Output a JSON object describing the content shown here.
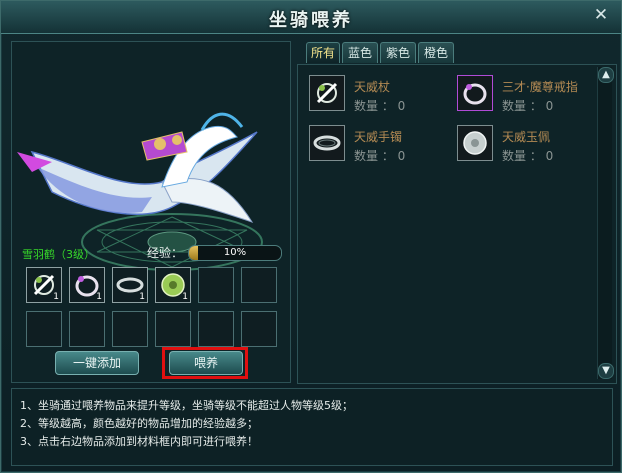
{
  "window": {
    "title": "坐骑喂养",
    "close_label": "✕"
  },
  "tabs": [
    {
      "label": "所有",
      "active": true
    },
    {
      "label": "蓝色",
      "active": false
    },
    {
      "label": "紫色",
      "active": false
    },
    {
      "label": "橙色",
      "active": false
    }
  ],
  "items": [
    {
      "name": "天威杖",
      "qty": "数量 ： 0",
      "icon": "staff-icon"
    },
    {
      "name": "三才·魔尊戒指",
      "qty": "数量 ： 0",
      "icon": "ring-icon"
    },
    {
      "name": "天威手镯",
      "qty": "数量 ： 0",
      "icon": "bracelet-icon"
    },
    {
      "name": "天威玉佩",
      "qty": "数量 ： 0",
      "icon": "jade-pendant-icon"
    }
  ],
  "mount": {
    "name": "雪羽鹤（3级）",
    "exp_label": "经验：",
    "exp_text": "10%",
    "exp_fraction": 0.1
  },
  "slots": [
    {
      "icon": "staff-icon",
      "count": "1"
    },
    {
      "icon": "ring-icon",
      "count": "1"
    },
    {
      "icon": "bracelet-icon",
      "count": "1"
    },
    {
      "icon": "jade-pendant-icon",
      "count": "1"
    }
  ],
  "buttons": {
    "add_all": "一键添加",
    "feed": "喂养"
  },
  "tips": [
    "1、坐骑通过喂养物品来提升等级，坐骑等级不能超过人物等级5级；",
    "2、等级越高，颜色越好的物品增加的经验越多；",
    "3、点击右边物品添加到材料框内即可进行喂养！"
  ],
  "colors": {
    "name_green": "#37d92a",
    "item_name": "#b38a53",
    "highlight": "#e01010"
  }
}
